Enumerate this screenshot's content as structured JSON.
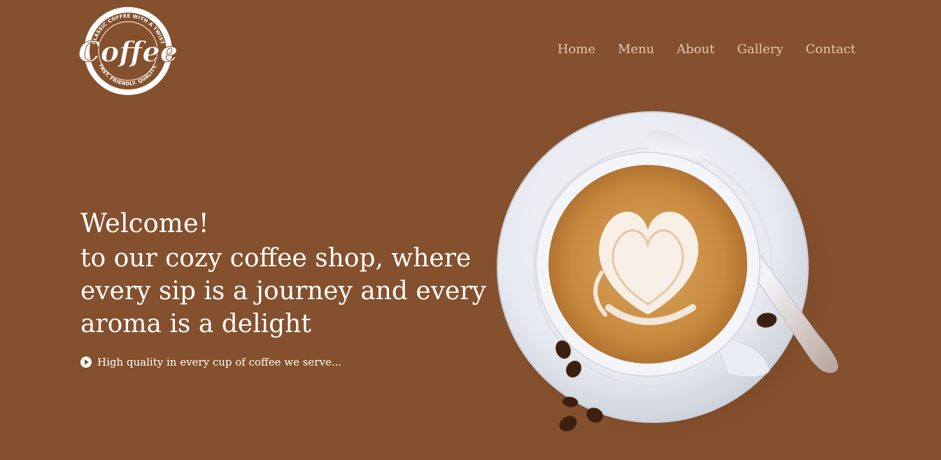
{
  "brand": {
    "logo_word": "Coffee",
    "logo_top_text": "CLASSIC COFFEE WITH A TWIST",
    "logo_bottom_text": "FAST. FRIENDLY. QUALITY."
  },
  "nav": {
    "items": [
      {
        "label": "Home"
      },
      {
        "label": "Menu"
      },
      {
        "label": "About"
      },
      {
        "label": "Gallery"
      },
      {
        "label": "Contact"
      }
    ]
  },
  "hero": {
    "title": "Welcome!",
    "subtitle": "to our cozy coffee shop, where every sip is a journey and every aroma is a delight",
    "tagline": "High quality in every cup of coffee we serve..."
  },
  "colors": {
    "background": "#85502d",
    "nav_text": "#e2c7b1",
    "text": "#ffffff"
  },
  "icons": {
    "tagline_icon": "play-circle-icon"
  }
}
